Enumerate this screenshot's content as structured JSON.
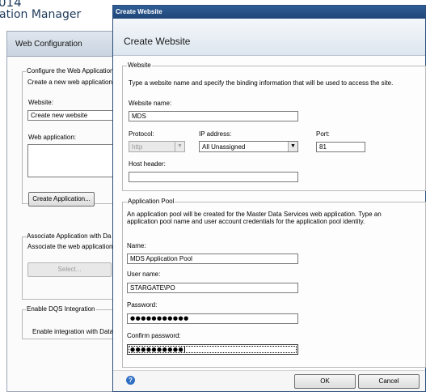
{
  "background_app": {
    "title_line1": "014",
    "title_line2": "ation Manager",
    "panel_header": "Web Configuration",
    "configure_group": {
      "title": "Configure the Web Application",
      "description": "Create a new web application",
      "website_label": "Website:",
      "website_value": "Create new website",
      "web_application_label": "Web application:",
      "create_application_button": "Create Application..."
    },
    "associate_group": {
      "title": "Associate Application with Da",
      "description": "Associate the web application",
      "select_button": "Select..."
    },
    "dqs_group": {
      "title": "Enable DQS Integration",
      "description": "Enable integration with Data"
    }
  },
  "dialog": {
    "window_title": "Create Website",
    "header_title": "Create Website",
    "website_section": {
      "legend": "Website",
      "description": "Type a website name and specify the binding information that will be used to access the site.",
      "website_name_label": "Website name:",
      "website_name_value": "MDS",
      "protocol_label": "Protocol:",
      "protocol_value": "http",
      "ip_address_label": "IP address:",
      "ip_address_value": "All Unassigned",
      "port_label": "Port:",
      "port_value": "81",
      "host_header_label": "Host header:",
      "host_header_value": ""
    },
    "app_pool_section": {
      "legend": "Application Pool",
      "description": "An application pool will be created for the Master Data Services web application.  Type an application pool name and user account credentials for the application pool identity.",
      "name_label": "Name:",
      "name_value": "MDS Application Pool",
      "user_name_label": "User name:",
      "user_name_value": "STARGATE\\PO",
      "password_label": "Password:",
      "password_value": "●●●●●●●●●●●",
      "confirm_password_label": "Confirm password:",
      "confirm_password_value": "●●●●●●●●●●"
    },
    "footer": {
      "help_icon": "?",
      "ok_label": "OK",
      "cancel_label": "Cancel"
    }
  }
}
